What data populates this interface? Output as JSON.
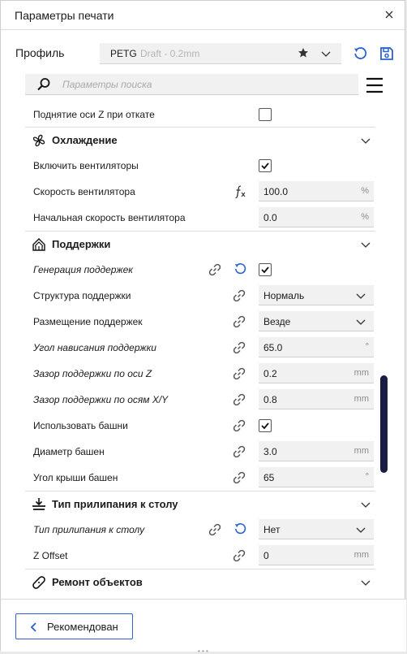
{
  "window": {
    "title": "Параметры печати"
  },
  "profile": {
    "label": "Профиль",
    "name": "PETG",
    "subtitle": "Draft - 0.2mm"
  },
  "search": {
    "placeholder": "Параметры поиска"
  },
  "settings": {
    "retract_z_hop": {
      "label": "Поднятие оси Z при откате",
      "checked": false
    },
    "cooling": {
      "title": "Охлаждение",
      "enable_fans": {
        "label": "Включить вентиляторы",
        "checked": true
      },
      "fan_speed": {
        "label": "Скорость вентилятора",
        "value": "100.0",
        "unit": "%"
      },
      "initial_fan_speed": {
        "label": "Начальная скорость вентилятора",
        "value": "0.0",
        "unit": "%"
      }
    },
    "support": {
      "title": "Поддержки",
      "generate": {
        "label": "Генерация поддержек",
        "checked": true
      },
      "structure": {
        "label": "Структура поддержки",
        "value": "Нормаль"
      },
      "placement": {
        "label": "Размещение поддержек",
        "value": "Везде"
      },
      "overhang_angle": {
        "label": "Угол нависания поддержки",
        "value": "65.0",
        "unit": "°"
      },
      "z_distance": {
        "label": "Зазор поддержки по оси Z",
        "value": "0.2",
        "unit": "mm"
      },
      "xy_distance": {
        "label": "Зазор поддержки по осям X/Y",
        "value": "0.8",
        "unit": "mm"
      },
      "use_towers": {
        "label": "Использовать башни",
        "checked": true
      },
      "tower_diameter": {
        "label": "Диаметр башен",
        "value": "3.0",
        "unit": "mm"
      },
      "tower_roof_angle": {
        "label": "Угол крыши башен",
        "value": "65",
        "unit": "°"
      }
    },
    "adhesion": {
      "title": "Тип прилипания к столу",
      "type": {
        "label": "Тип прилипания к столу",
        "value": "Нет"
      },
      "z_offset": {
        "label": "Z Offset",
        "value": "0",
        "unit": "mm"
      }
    },
    "mesh_fixes": {
      "title": "Ремонт объектов"
    }
  },
  "footer": {
    "recommended_label": "Рекомендован"
  },
  "colors": {
    "accent": "#2a60d3",
    "scrollbar": "#1a1c43"
  }
}
